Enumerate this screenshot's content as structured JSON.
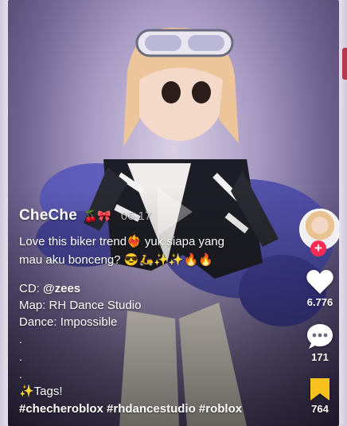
{
  "post": {
    "username": "CheChe",
    "username_emoji": "🍒🎀",
    "date": "06-17",
    "caption_line1": "Love this biker trend❤️‍🔥  yuk siapa yang",
    "caption_line2": "mau aku bonceng? 😎🛵✨✨🔥🔥",
    "credits": {
      "cd_label": "CD: ",
      "cd_value": "@zees",
      "map": "Map: RH Dance Studio",
      "dance": "Dance: Impossible"
    },
    "dots": [
      ".",
      ".",
      "."
    ],
    "tags_label": "✨Tags!",
    "hashtags": "#checheroblox #rhdancestudio #roblox"
  },
  "actions": {
    "follow_symbol": "+",
    "likes": "6.776",
    "comments": "171",
    "saves": "764"
  },
  "colors": {
    "follow_accent": "#fe2c55",
    "save_icon": "#f7c21d",
    "text": "#ffffff"
  },
  "icons": {
    "like": "heart-icon",
    "comment": "comment-bubble-icon",
    "save": "bookmark-icon",
    "play": "play-icon"
  }
}
